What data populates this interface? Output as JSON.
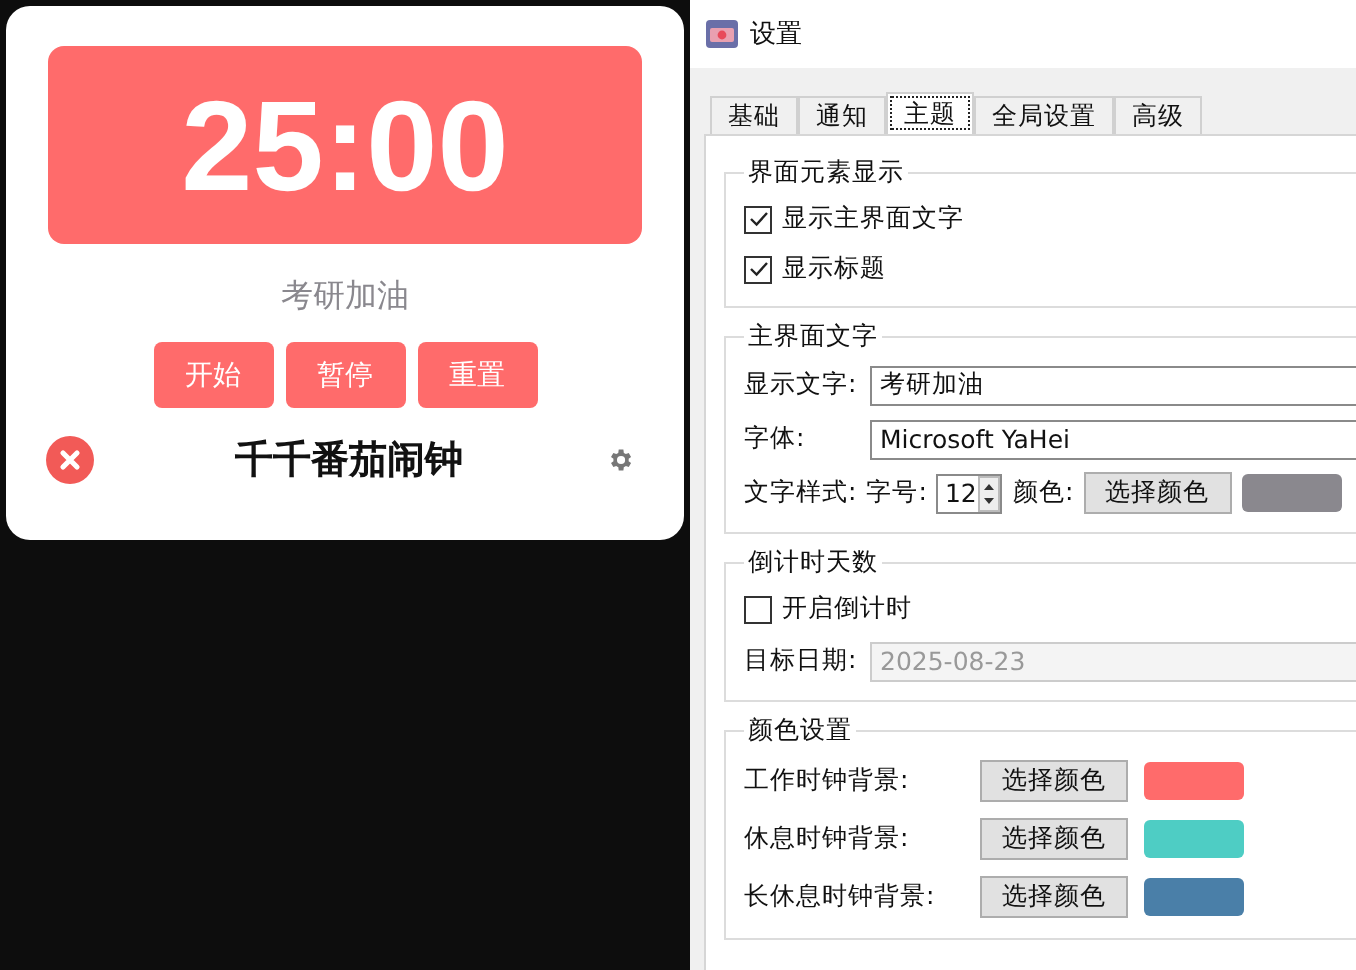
{
  "timer_widget": {
    "time": "25:00",
    "motto": "考研加油",
    "buttons": [
      "开始",
      "暂停",
      "重置"
    ],
    "title": "千千番茄闹钟"
  },
  "settings": {
    "window_title": "设置",
    "tabs": [
      {
        "label": "基础",
        "selected": false
      },
      {
        "label": "通知",
        "selected": false
      },
      {
        "label": "主题",
        "selected": true
      },
      {
        "label": "全局设置",
        "selected": false
      },
      {
        "label": "高级",
        "selected": false
      }
    ],
    "display_group": {
      "title": "界面元素显示",
      "options": [
        {
          "label": "显示主界面文字",
          "checked": true
        },
        {
          "label": "显示标题",
          "checked": true
        }
      ]
    },
    "main_text_group": {
      "title": "主界面文字",
      "text_label": "显示文字:",
      "text_value": "考研加油",
      "font_label": "字体:",
      "font_value": "Microsoft YaHei",
      "style_label": "文字样式:",
      "size_label": "字号:",
      "size_value": "12",
      "color_label": "颜色:",
      "color_button": "选择颜色",
      "color": "#8a888e"
    },
    "countdown_group": {
      "title": "倒计时天数",
      "option": {
        "label": "开启倒计时",
        "checked": false
      },
      "date_label": "目标日期:",
      "date_value": "2025-08-23",
      "disabled": true
    },
    "colors_group": {
      "title": "颜色设置",
      "rows": [
        {
          "label": "工作时钟背景:",
          "button": "选择颜色",
          "color": "#ff6b6b"
        },
        {
          "label": "休息时钟背景:",
          "button": "选择颜色",
          "color": "#4ecdc4"
        },
        {
          "label": "长休息时钟背景:",
          "button": "选择颜色",
          "color": "#4a7fa8"
        }
      ]
    }
  }
}
